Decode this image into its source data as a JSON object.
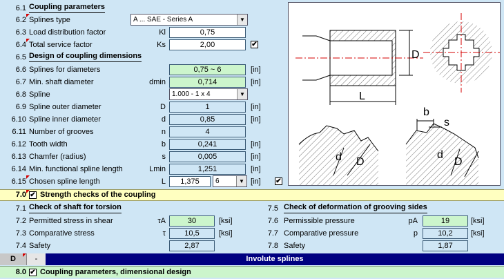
{
  "section_6": {
    "header": {
      "num": "6.1",
      "label": "Coupling parameters"
    },
    "splines_type": {
      "num": "6.2",
      "label": "Splines type",
      "value": "A ... SAE  -  Series A"
    },
    "load_factor": {
      "num": "6.3",
      "label": "Load distribution factor",
      "sym": "Kl",
      "value": "0,75"
    },
    "service_factor": {
      "num": "6.4",
      "label": "Total service factor",
      "sym": "Ks",
      "value": "2,00",
      "checked": "✔"
    },
    "design_header": {
      "num": "6.5",
      "label": "Design of coupling dimensions"
    },
    "splines_for_diam": {
      "num": "6.6",
      "label": "Splines for diameters",
      "value": "0,75 ~ 6",
      "unit": "[in]"
    },
    "min_shaft": {
      "num": "6.7",
      "label": "Min. shaft diameter",
      "sym": "dmin",
      "value": "0,714",
      "unit": "[in]"
    },
    "spline": {
      "num": "6.8",
      "label": "Spline",
      "value": "1.000 - 1 x 4"
    },
    "outer_diam": {
      "num": "6.9",
      "label": "Spline outer diameter",
      "sym": "D",
      "value": "1",
      "unit": "[in]"
    },
    "inner_diam": {
      "num": "6.10",
      "label": "Spline inner diameter",
      "sym": "d",
      "value": "0,85",
      "unit": "[in]"
    },
    "grooves": {
      "num": "6.11",
      "label": "Number of grooves",
      "sym": "n",
      "value": "4"
    },
    "tooth_width": {
      "num": "6.12",
      "label": "Tooth width",
      "sym": "b",
      "value": "0,241",
      "unit": "[in]"
    },
    "chamfer": {
      "num": "6.13",
      "label": "Chamfer (radius)",
      "sym": "s",
      "value": "0,005",
      "unit": "[in]"
    },
    "min_length": {
      "num": "6.14",
      "label": "Min. functional spline length",
      "sym": "Lmin",
      "value": "1,251",
      "unit": "[in]"
    },
    "chosen_length": {
      "num": "6.15",
      "label": "Chosen spline length",
      "sym": "L",
      "value": "1,375",
      "select": "6",
      "unit": "[in]",
      "checked": "✔"
    }
  },
  "section_7": {
    "band": {
      "num": "7.0",
      "label": "Strength checks of the coupling",
      "checked": "✔"
    },
    "torsion": {
      "header": {
        "num": "7.1",
        "label": "Check of shaft for torsion"
      },
      "permitted": {
        "num": "7.2",
        "label": "Permitted stress in shear",
        "sym": "τA",
        "value": "30",
        "unit": "[ksi]"
      },
      "comparative": {
        "num": "7.3",
        "label": "Comparative stress",
        "sym": "τ",
        "value": "10,5",
        "unit": "[ksi]"
      },
      "safety": {
        "num": "7.4",
        "label": "Safety",
        "value": "2,87"
      }
    },
    "deformation": {
      "header": {
        "num": "7.5",
        "label": "Check of deformation of grooving sides"
      },
      "permissible": {
        "num": "7.6",
        "label": "Permissible pressure",
        "sym": "pA",
        "value": "19",
        "unit": "[ksi]"
      },
      "comparative": {
        "num": "7.7",
        "label": "Comparative pressure",
        "sym": "p",
        "value": "10,2",
        "unit": "[ksi]"
      },
      "safety": {
        "num": "7.8",
        "label": "Safety",
        "value": "1,87"
      }
    }
  },
  "bar_d": {
    "code": "D",
    "dash": "-",
    "title": "Involute splines"
  },
  "section_8": {
    "num": "8.0",
    "label": "Coupling parameters, dimensional design",
    "checked": "✔"
  },
  "drawing": {
    "L": "L",
    "D": "D",
    "b": "b",
    "s": "s",
    "d1": "d",
    "D1": "D",
    "d2": "d",
    "D2": "D"
  },
  "colors": {
    "background": "#cfe6f5",
    "input_green": "#ccf5cc",
    "band_yellow": "#ffffc0",
    "band_navy": "#000080",
    "accent_red": "#d40000"
  }
}
